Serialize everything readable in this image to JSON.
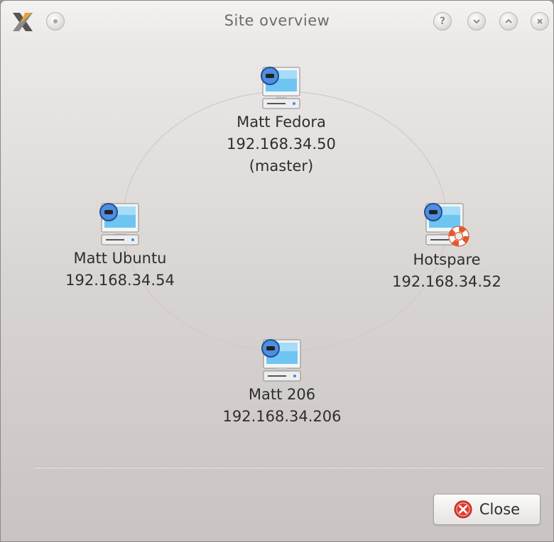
{
  "window": {
    "title": "Site overview",
    "app_icon": "x-app-icon",
    "titlebar_buttons": [
      "menu-icon",
      "help-icon",
      "minimize-icon",
      "maximize-icon",
      "close-icon"
    ]
  },
  "nodes": [
    {
      "name": "Matt Fedora",
      "ip": "192.168.34.50",
      "role": "(master)",
      "icon": "computer-icon"
    },
    {
      "name": "Matt Ubuntu",
      "ip": "192.168.34.54",
      "icon": "computer-icon"
    },
    {
      "name": "Hotspare",
      "ip": "192.168.34.52",
      "icon": "computer-hotspare-icon"
    },
    {
      "name": "Matt 206",
      "ip": "192.168.34.206",
      "icon": "computer-icon"
    }
  ],
  "footer": {
    "close_label": "Close",
    "close_icon": "red-x-circle-icon"
  },
  "colors": {
    "close_icon_red": "#e0382f",
    "monitor_blue": "#3a8ee6",
    "lifebuoy_orange": "#e8572a"
  }
}
